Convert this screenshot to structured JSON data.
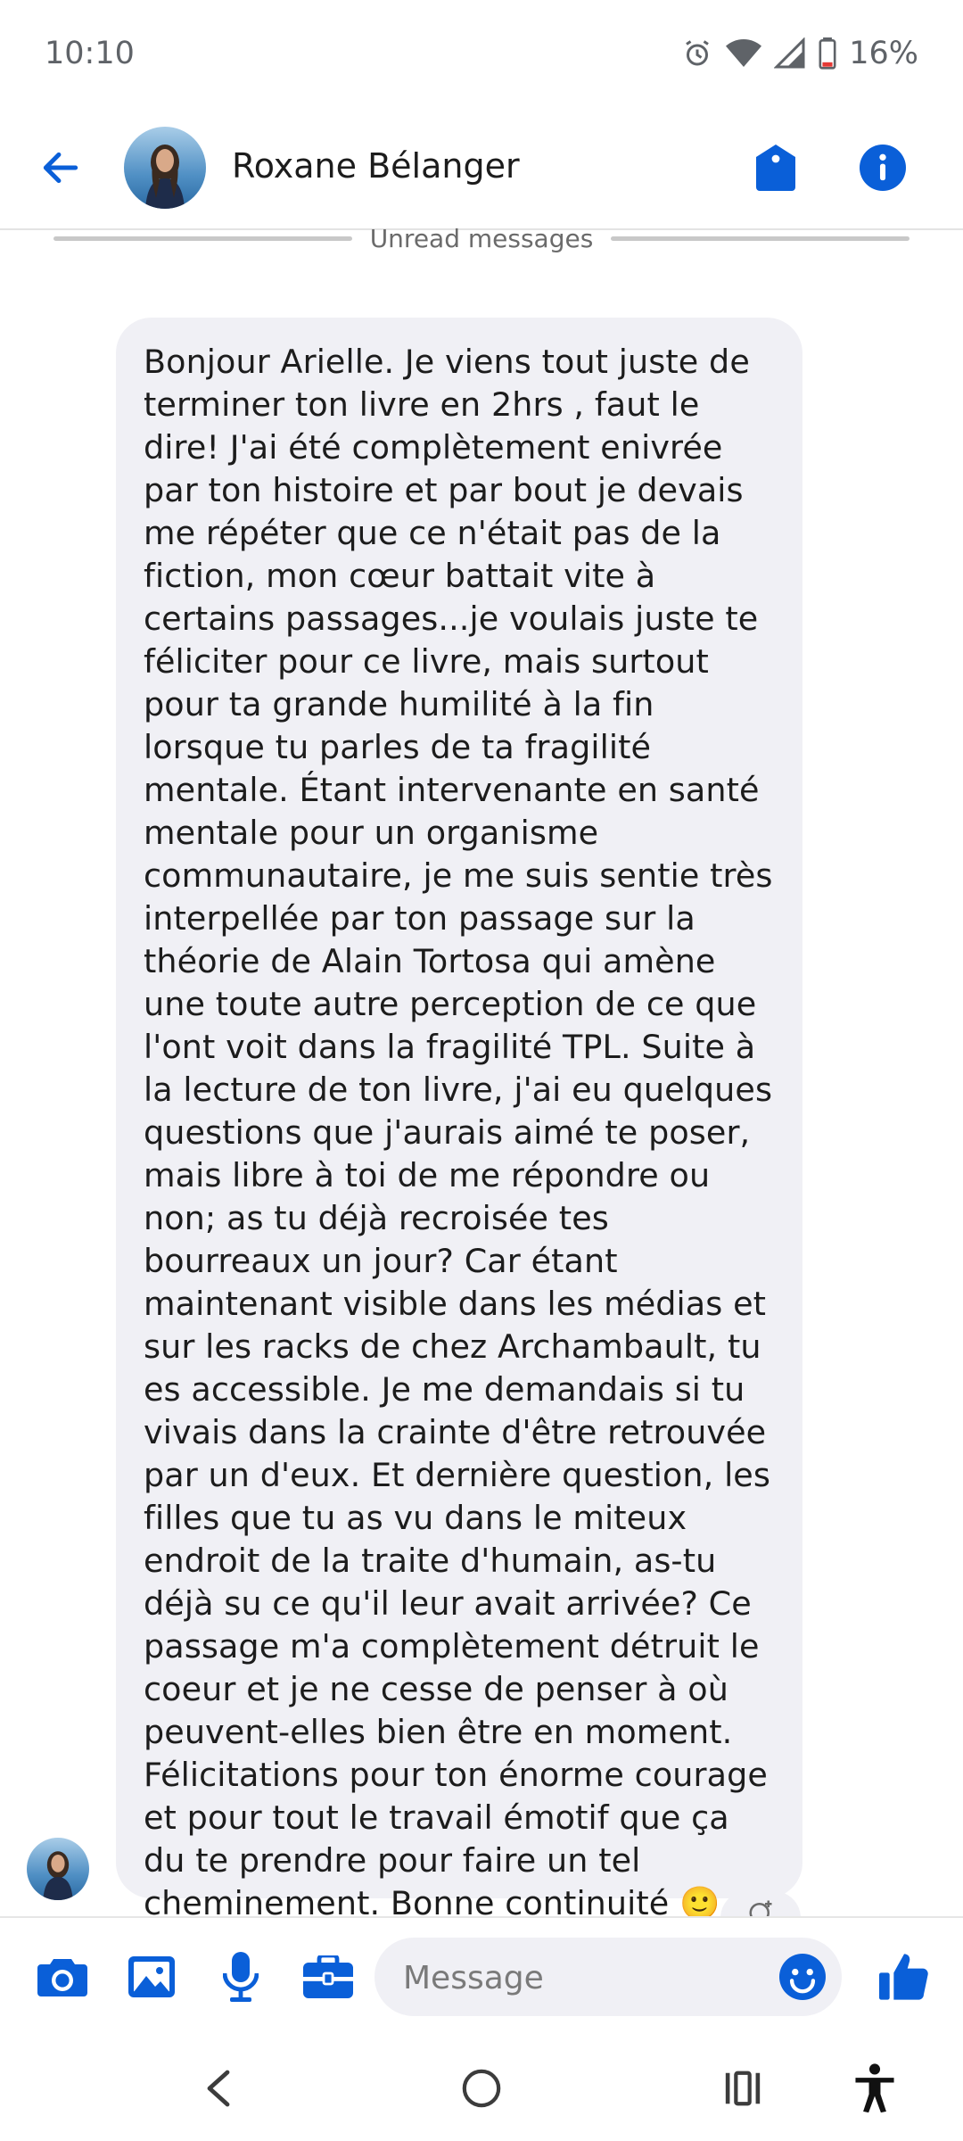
{
  "status_bar": {
    "time": "10:10",
    "battery": "16%",
    "icons": [
      "alarm-icon",
      "wifi-icon",
      "signal-icon",
      "battery-icon"
    ]
  },
  "header": {
    "contact_name": "Roxane Bélanger",
    "icons": [
      "back-arrow-icon",
      "tag-icon",
      "info-icon"
    ]
  },
  "divider": {
    "label": "Unread messages"
  },
  "message": {
    "text": "Bonjour Arielle. Je viens tout juste de terminer ton livre en 2hrs , faut le dire! J'ai été complètement enivrée par ton histoire et par bout je devais me répéter que ce n'était pas de la fiction, mon cœur battait vite à certains passages...je voulais juste te féliciter pour ce livre, mais surtout pour ta grande humilité à la fin lorsque tu parles de ta fragilité mentale. Étant intervenante en santé mentale pour un organisme communautaire, je me suis sentie très interpellée par ton passage sur la théorie de Alain Tortosa qui amène une toute autre perception de ce que l'ont voit dans la fragilité TPL. Suite à la lecture de ton livre, j'ai eu quelques questions que j'aurais aimé te poser, mais libre à toi de me répondre ou non; as tu déjà recroisée tes bourreaux un jour? Car étant maintenant visible dans les médias et sur les racks de chez Archambault, tu es accessible. Je me demandais si tu vivais dans la crainte d'être retrouvée par un d'eux. Et dernière question, les filles que tu as vu dans le miteux endroit de la traite d'humain, as-tu déjà su ce qu'il leur avait arrivée? Ce passage m'a complètement détruit le coeur et je ne cesse de penser à où peuvent-elles bien être en moment. Félicitations pour ton énorme courage et pour tout le travail émotif que ça du te prendre pour faire un tel cheminement. Bonne continuité 🙂"
  },
  "composer": {
    "placeholder": "Message",
    "icons": [
      "camera-icon",
      "image-icon",
      "microphone-icon",
      "briefcase-icon",
      "emoji-icon",
      "thumbs-up-icon"
    ]
  },
  "nav_bar": {
    "icons": [
      "back-nav-icon",
      "home-nav-icon",
      "recents-nav-icon",
      "accessibility-icon"
    ]
  },
  "colors": {
    "accent": "#0a5fd8",
    "bubble": "#f0f0f5",
    "status_text": "#5f6368",
    "battery_low": "#e53935"
  }
}
